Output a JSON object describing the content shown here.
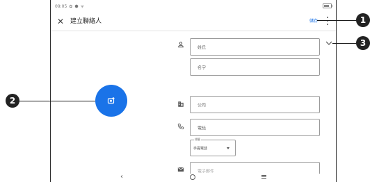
{
  "status_bar": {
    "time": "09:05",
    "icons": [
      "gear-icon",
      "shield-icon",
      "wifi-icon"
    ]
  },
  "app_bar": {
    "close_icon": "close-icon",
    "title": "建立聯絡人",
    "save_label": "儲存",
    "more_icon": "more-vert-icon"
  },
  "photo_button": {
    "icon": "add-photo-icon",
    "color": "#1a73e8"
  },
  "form": {
    "surname_placeholder": "姓氏",
    "given_name_placeholder": "名字",
    "company_placeholder": "公司",
    "phone_placeholder": "電話",
    "phone_type_label": "標籤",
    "phone_type_value": "手提電話",
    "email_placeholder": "電子郵件"
  },
  "callouts": [
    {
      "label": "1"
    },
    {
      "label": "2"
    },
    {
      "label": "3"
    }
  ]
}
